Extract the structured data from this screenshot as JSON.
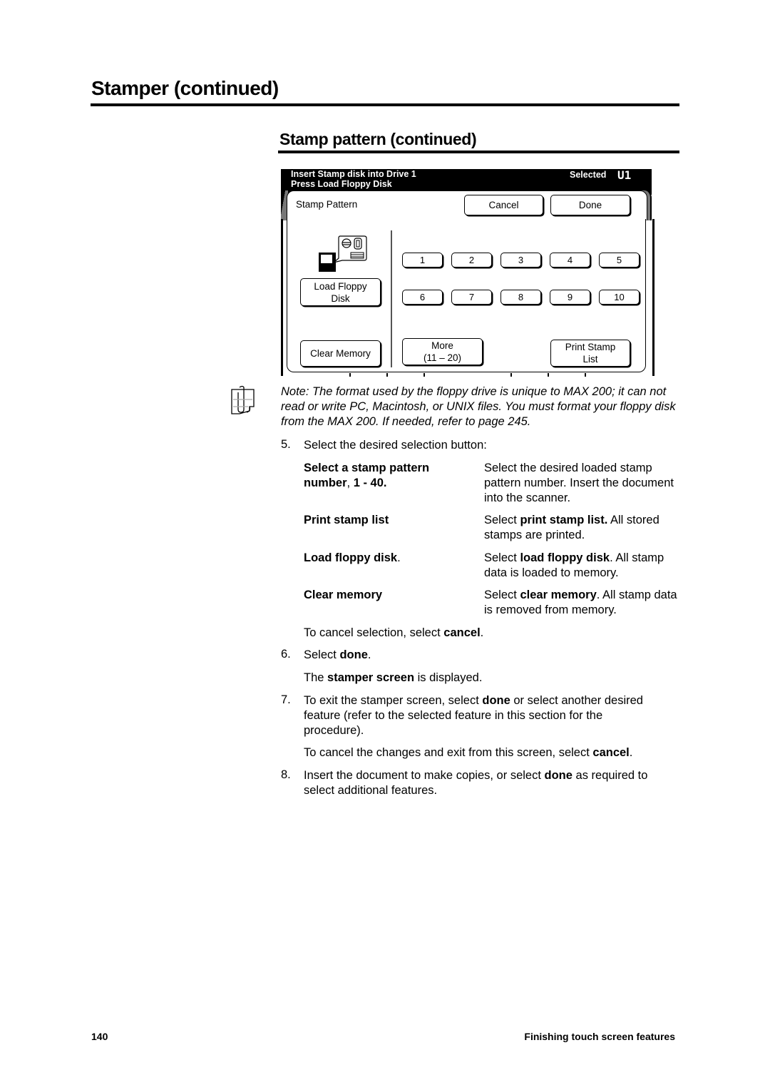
{
  "page": {
    "heading": "Stamper (continued)",
    "subheading": "Stamp pattern (continued)"
  },
  "screen": {
    "message_line1": "Insert Stamp disk into Drive 1",
    "message_line2": "Press Load Floppy Disk",
    "selected_label": "Selected",
    "selected_value": "U1",
    "tab_label": "Stamp Pattern",
    "cancel_label": "Cancel",
    "done_label": "Done",
    "load_floppy_line1": "Load Floppy",
    "load_floppy_line2": "Disk",
    "clear_memory_label": "Clear Memory",
    "more_line1": "More",
    "more_line2": "(11 – 20)",
    "print_stamp_line1": "Print Stamp",
    "print_stamp_line2": "List",
    "number_buttons": [
      "1",
      "2",
      "3",
      "4",
      "5",
      "6",
      "7",
      "8",
      "9",
      "10"
    ],
    "icons": {
      "floppy": "floppy-disk-load-icon",
      "note": "note-hand-icon"
    }
  },
  "note": {
    "text": "Note:  The format used by the floppy drive is unique to MAX 200; it can not read or write PC, Macintosh, or UNIX files.  You must format your floppy disk from the MAX 200.  If needed, refer to page 245."
  },
  "steps": {
    "step5_num": "5.",
    "step5_text": "Select the desired selection button:",
    "options": [
      {
        "term_bold": "Select a stamp pattern number",
        "term_normal": ",",
        "term_bold2": " 1 - 40.",
        "def_pre": "Select the desired loaded stamp pattern number.  Insert the document into the scanner.",
        "def_bold": "",
        "def_post": ""
      },
      {
        "term_bold": "Print stamp list",
        "term_normal": "",
        "term_bold2": "",
        "def_pre": "Select ",
        "def_bold": "print stamp list.",
        "def_post": "  All stored stamps are printed."
      },
      {
        "term_bold": "Load floppy disk",
        "term_normal": ".",
        "term_bold2": "",
        "def_pre": "Select ",
        "def_bold": "load floppy disk",
        "def_post": ".  All stamp data is loaded to memory."
      },
      {
        "term_bold": "Clear memory",
        "term_normal": "",
        "term_bold2": "",
        "def_pre": "Select ",
        "def_bold": "clear memory",
        "def_post": ".  All stamp data is removed from memory."
      }
    ],
    "cancel_pre": "To cancel selection, select ",
    "cancel_bold": "cancel",
    "cancel_post": ".",
    "step6_num": "6.",
    "step6_pre": "Select ",
    "step6_bold": "done",
    "step6_post": ".",
    "stamper_pre": "The ",
    "stamper_bold": "stamper screen",
    "stamper_post": " is displayed.",
    "step7_num": "7.",
    "step7_pre": "To exit the stamper screen, select ",
    "step7_bold": "done",
    "step7_post": " or select another desired feature (refer to the selected feature in this section for the procedure).",
    "cancel2_pre": "To cancel the changes and exit from this screen, select ",
    "cancel2_bold": "cancel",
    "cancel2_post": ".",
    "step8_num": "8.",
    "step8_pre": "Insert the document to make copies, or select ",
    "step8_bold": "done",
    "step8_post": " as required to select additional features."
  },
  "footer": {
    "page_number": "140",
    "section_title": "Finishing touch screen features"
  }
}
